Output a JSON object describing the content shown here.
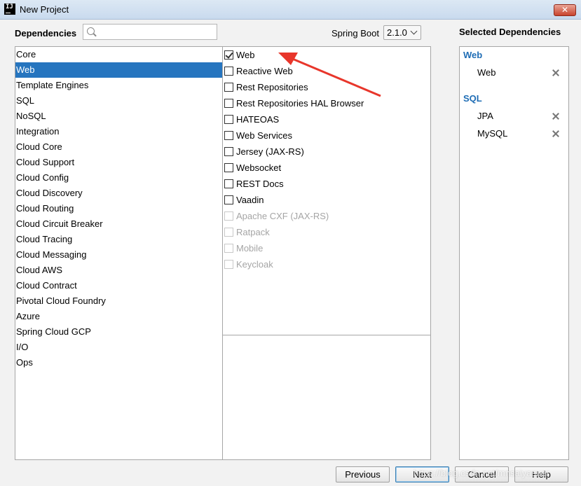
{
  "window": {
    "title": "New Project",
    "close_glyph": "✕"
  },
  "header": {
    "dependencies_label": "Dependencies",
    "search_value": "",
    "spring_boot_label": "Spring Boot",
    "spring_boot_version": "2.1.0"
  },
  "categories": [
    "Core",
    "Web",
    "Template Engines",
    "SQL",
    "NoSQL",
    "Integration",
    "Cloud Core",
    "Cloud Support",
    "Cloud Config",
    "Cloud Discovery",
    "Cloud Routing",
    "Cloud Circuit Breaker",
    "Cloud Tracing",
    "Cloud Messaging",
    "Cloud AWS",
    "Cloud Contract",
    "Pivotal Cloud Foundry",
    "Azure",
    "Spring Cloud GCP",
    "I/O",
    "Ops"
  ],
  "selected_category": "Web",
  "dependencies": [
    {
      "label": "Web",
      "checked": true,
      "enabled": true
    },
    {
      "label": "Reactive Web",
      "checked": false,
      "enabled": true
    },
    {
      "label": "Rest Repositories",
      "checked": false,
      "enabled": true
    },
    {
      "label": "Rest Repositories HAL Browser",
      "checked": false,
      "enabled": true
    },
    {
      "label": "HATEOAS",
      "checked": false,
      "enabled": true
    },
    {
      "label": "Web Services",
      "checked": false,
      "enabled": true
    },
    {
      "label": "Jersey (JAX-RS)",
      "checked": false,
      "enabled": true
    },
    {
      "label": "Websocket",
      "checked": false,
      "enabled": true
    },
    {
      "label": "REST Docs",
      "checked": false,
      "enabled": true
    },
    {
      "label": "Vaadin",
      "checked": false,
      "enabled": true
    },
    {
      "label": "Apache CXF (JAX-RS)",
      "checked": false,
      "enabled": false
    },
    {
      "label": "Ratpack",
      "checked": false,
      "enabled": false
    },
    {
      "label": "Mobile",
      "checked": false,
      "enabled": false
    },
    {
      "label": "Keycloak",
      "checked": false,
      "enabled": false
    }
  ],
  "selected_panel": {
    "title": "Selected Dependencies",
    "groups": [
      {
        "name": "Web",
        "items": [
          "Web"
        ]
      },
      {
        "name": "SQL",
        "items": [
          "JPA",
          "MySQL"
        ]
      }
    ]
  },
  "buttons": {
    "previous": "Previous",
    "next": "Next",
    "cancel": "Cancel",
    "help": "Help"
  },
  "watermark": "https://blog.csdn.net/mnsaiyasuer",
  "colors": {
    "selection": "#2675bf",
    "group_title": "#1f6db5",
    "arrow": "#e8362b"
  }
}
